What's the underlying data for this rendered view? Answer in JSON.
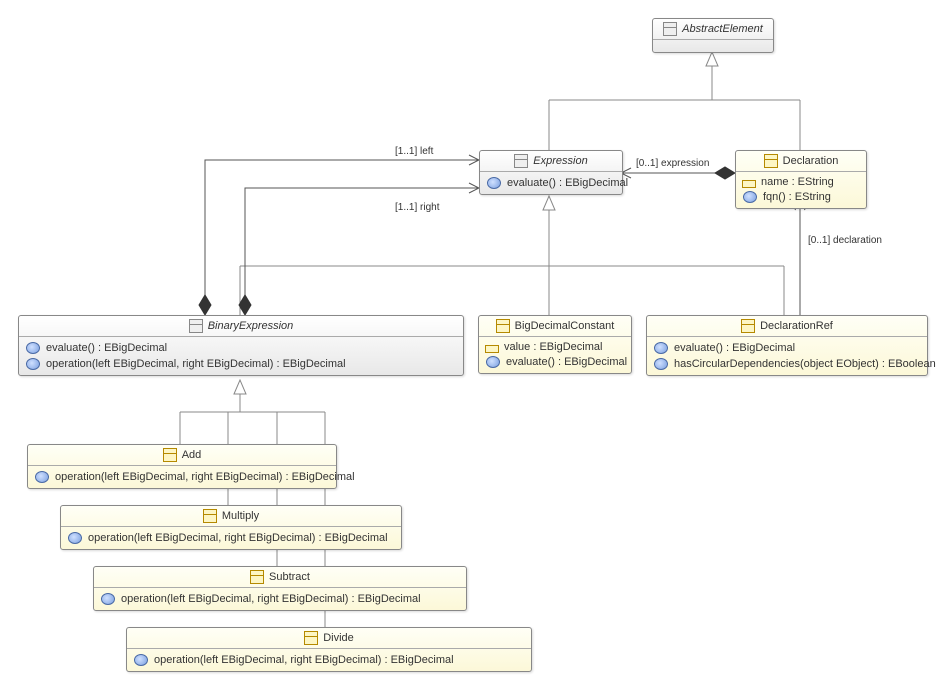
{
  "chart_data": {
    "type": "uml-class-diagram",
    "classes": [
      {
        "id": "AbstractElement",
        "abstract": true,
        "attributes": [],
        "operations": []
      },
      {
        "id": "Expression",
        "abstract": true,
        "attributes": [],
        "operations": [
          "evaluate() : EBigDecimal"
        ]
      },
      {
        "id": "Declaration",
        "abstract": false,
        "attributes": [
          "name : EString"
        ],
        "operations": [
          "fqn() : EString"
        ]
      },
      {
        "id": "BinaryExpression",
        "abstract": true,
        "attributes": [],
        "operations": [
          "evaluate() : EBigDecimal",
          "operation(left EBigDecimal, right EBigDecimal) : EBigDecimal"
        ]
      },
      {
        "id": "BigDecimalConstant",
        "abstract": false,
        "attributes": [
          "value : EBigDecimal"
        ],
        "operations": [
          "evaluate() : EBigDecimal"
        ]
      },
      {
        "id": "DeclarationRef",
        "abstract": false,
        "attributes": [],
        "operations": [
          "evaluate() : EBigDecimal",
          "hasCircularDependencies(object EObject) : EBoolean"
        ]
      },
      {
        "id": "Add",
        "abstract": false,
        "attributes": [],
        "operations": [
          "operation(left EBigDecimal, right EBigDecimal) : EBigDecimal"
        ]
      },
      {
        "id": "Multiply",
        "abstract": false,
        "attributes": [],
        "operations": [
          "operation(left EBigDecimal, right EBigDecimal) : EBigDecimal"
        ]
      },
      {
        "id": "Subtract",
        "abstract": false,
        "attributes": [],
        "operations": [
          "operation(left EBigDecimal, right EBigDecimal) : EBigDecimal"
        ]
      },
      {
        "id": "Divide",
        "abstract": false,
        "attributes": [],
        "operations": [
          "operation(left EBigDecimal, right EBigDecimal) : EBigDecimal"
        ]
      }
    ],
    "generalizations": [
      {
        "child": "Expression",
        "parent": "AbstractElement"
      },
      {
        "child": "Declaration",
        "parent": "AbstractElement"
      },
      {
        "child": "BinaryExpression",
        "parent": "Expression"
      },
      {
        "child": "BigDecimalConstant",
        "parent": "Expression"
      },
      {
        "child": "DeclarationRef",
        "parent": "Expression"
      },
      {
        "child": "Add",
        "parent": "BinaryExpression"
      },
      {
        "child": "Multiply",
        "parent": "BinaryExpression"
      },
      {
        "child": "Subtract",
        "parent": "BinaryExpression"
      },
      {
        "child": "Divide",
        "parent": "BinaryExpression"
      }
    ],
    "associations": [
      {
        "from": "BinaryExpression",
        "to": "Expression",
        "role": "left",
        "multiplicity": "[1..1]",
        "kind": "composition"
      },
      {
        "from": "BinaryExpression",
        "to": "Expression",
        "role": "right",
        "multiplicity": "[1..1]",
        "kind": "composition"
      },
      {
        "from": "Declaration",
        "to": "Expression",
        "role": "expression",
        "multiplicity": "[0..1]",
        "kind": "composition"
      },
      {
        "from": "DeclarationRef",
        "to": "Declaration",
        "role": "declaration",
        "multiplicity": "[0..1]",
        "kind": "reference"
      }
    ]
  },
  "classes": {
    "AbstractElement": {
      "name": "AbstractElement"
    },
    "Expression": {
      "name": "Expression",
      "op0": "evaluate() : EBigDecimal"
    },
    "Declaration": {
      "name": "Declaration",
      "attr0": "name : EString",
      "op0": "fqn() : EString"
    },
    "BinaryExpression": {
      "name": "BinaryExpression",
      "op0": "evaluate() : EBigDecimal",
      "op1": "operation(left EBigDecimal, right EBigDecimal) : EBigDecimal"
    },
    "BigDecimalConstant": {
      "name": "BigDecimalConstant",
      "attr0": "value : EBigDecimal",
      "op0": "evaluate() : EBigDecimal"
    },
    "DeclarationRef": {
      "name": "DeclarationRef",
      "op0": "evaluate() : EBigDecimal",
      "op1": "hasCircularDependencies(object EObject) : EBoolean"
    },
    "Add": {
      "name": "Add",
      "op0": "operation(left EBigDecimal, right EBigDecimal) : EBigDecimal"
    },
    "Multiply": {
      "name": "Multiply",
      "op0": "operation(left EBigDecimal, right EBigDecimal) : EBigDecimal"
    },
    "Subtract": {
      "name": "Subtract",
      "op0": "operation(left EBigDecimal, right EBigDecimal) : EBigDecimal"
    },
    "Divide": {
      "name": "Divide",
      "op0": "operation(left EBigDecimal, right EBigDecimal) : EBigDecimal"
    }
  },
  "labels": {
    "left": "[1..1] left",
    "right": "[1..1] right",
    "expression": "[0..1] expression",
    "declaration": "[0..1] declaration"
  }
}
